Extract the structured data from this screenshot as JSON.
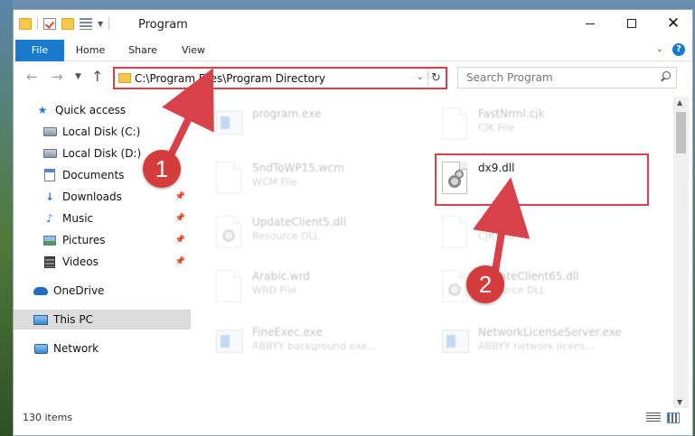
{
  "window": {
    "title": "Program",
    "controls": {
      "minimize_icon": "minimize-icon",
      "maximize_icon": "maximize-icon",
      "close_label": "✕"
    }
  },
  "ribbon": {
    "tabs": [
      {
        "label": "File",
        "active": true
      },
      {
        "label": "Home"
      },
      {
        "label": "Share"
      },
      {
        "label": "View"
      }
    ],
    "help_label": "?"
  },
  "navbar": {
    "address": "C:\\Program Files\\Program Directory",
    "search_placeholder": "Search Program"
  },
  "sidebar": {
    "items": [
      {
        "label": "Quick access",
        "icon": "star-icon"
      },
      {
        "label": "Local Disk (C:)",
        "icon": "disk-icon"
      },
      {
        "label": "Local Disk (D:)",
        "icon": "disk-icon"
      },
      {
        "label": "Documents",
        "icon": "document-icon"
      },
      {
        "label": "Downloads",
        "icon": "download-icon",
        "pinned": true
      },
      {
        "label": "Music",
        "icon": "music-icon",
        "pinned": true
      },
      {
        "label": "Pictures",
        "icon": "pictures-icon",
        "pinned": true
      },
      {
        "label": "Videos",
        "icon": "videos-icon",
        "pinned": true
      },
      {
        "label": "OneDrive",
        "icon": "cloud-icon"
      },
      {
        "label": "This PC",
        "icon": "computer-icon",
        "selected": true
      },
      {
        "label": "Network",
        "icon": "network-icon"
      }
    ]
  },
  "files": [
    {
      "name": "program.exe",
      "type": "",
      "icon": "exe-icon"
    },
    {
      "name": "FastNrml.cjk",
      "type": "CJK File",
      "icon": "file-icon"
    },
    {
      "name": "SndToWP15.wcm",
      "type": "WCM File",
      "icon": "file-icon"
    },
    {
      "name": "dx9.dll",
      "type": "",
      "icon": "dll-icon",
      "highlighted": true
    },
    {
      "name": "UpdateClient5.dll",
      "type": "Resource DLL",
      "icon": "dll-icon"
    },
    {
      "name": "",
      "type": "CJK File",
      "icon": "file-icon"
    },
    {
      "name": "Arabic.wrd",
      "type": "WRD File",
      "icon": "file-icon"
    },
    {
      "name": "UpdateClient65.dll",
      "type": "Resource DLL",
      "icon": "dll-icon"
    },
    {
      "name": "FineExec.exe",
      "type": "ABBYY background exe...",
      "icon": "exe-icon"
    },
    {
      "name": "NetworkLicenseServer.exe",
      "type": "ABBYY network licens...",
      "icon": "exe-icon"
    }
  ],
  "status": {
    "item_count": "130 items"
  },
  "annotations": {
    "step1": "1",
    "step2": "2",
    "accent_color": "#d9414a"
  }
}
